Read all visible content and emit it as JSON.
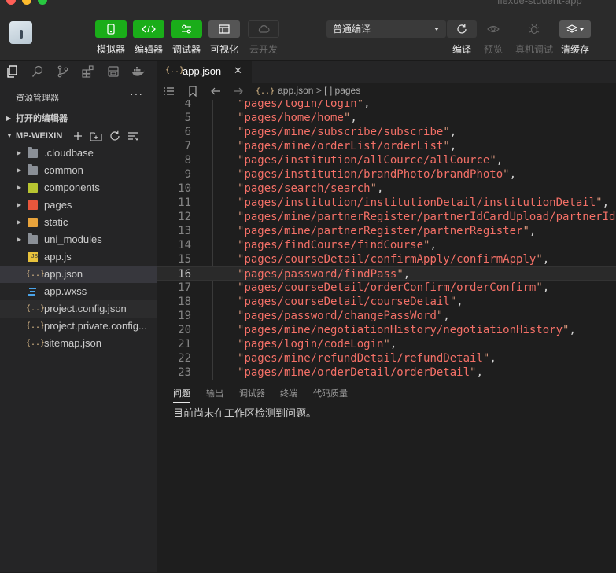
{
  "window": {
    "title": "flexue-student-app"
  },
  "toolbar": {
    "simulator_label": "模拟器",
    "editor_label": "编辑器",
    "debugger_label": "调试器",
    "visual_label": "可视化",
    "cloud_label": "云开发",
    "compile_mode": "普通编译",
    "compile_label": "编译",
    "preview_label": "预览",
    "remote_debug_label": "真机调试",
    "clear_cache_label": "清缓存"
  },
  "sidebar": {
    "title": "资源管理器",
    "more": "···",
    "open_editors": "打开的编辑器",
    "project": "MP-WEIXIN",
    "tree": [
      {
        "name": ".cloudbase",
        "type": "folder"
      },
      {
        "name": "common",
        "type": "folder"
      },
      {
        "name": "components",
        "type": "folder"
      },
      {
        "name": "pages",
        "type": "folder"
      },
      {
        "name": "static",
        "type": "folder"
      },
      {
        "name": "uni_modules",
        "type": "folder"
      },
      {
        "name": "app.js",
        "type": "file"
      },
      {
        "name": "app.json",
        "type": "file"
      },
      {
        "name": "app.wxss",
        "type": "file"
      },
      {
        "name": "project.config.json",
        "type": "file"
      },
      {
        "name": "project.private.config...",
        "type": "file"
      },
      {
        "name": "sitemap.json",
        "type": "file"
      }
    ]
  },
  "editor": {
    "tab": {
      "name": "app.json",
      "icon": "{..}",
      "close": "✕"
    },
    "breadcrumb": {
      "file": "app.json",
      "sep": ">",
      "node_icon": "[ ]",
      "node": "pages"
    },
    "current_line": 16,
    "lines": [
      {
        "n": "4",
        "text": "pages/login/login"
      },
      {
        "n": "5",
        "text": "pages/home/home"
      },
      {
        "n": "6",
        "text": "pages/mine/subscribe/subscribe"
      },
      {
        "n": "7",
        "text": "pages/mine/orderList/orderList"
      },
      {
        "n": "8",
        "text": "pages/institution/allCource/allCource"
      },
      {
        "n": "9",
        "text": "pages/institution/brandPhoto/brandPhoto"
      },
      {
        "n": "10",
        "text": "pages/search/search"
      },
      {
        "n": "11",
        "text": "pages/institution/institutionDetail/institutionDetail"
      },
      {
        "n": "12",
        "text": "pages/mine/partnerRegister/partnerIdCardUpload/partnerId"
      },
      {
        "n": "13",
        "text": "pages/mine/partnerRegister/partnerRegister"
      },
      {
        "n": "14",
        "text": "pages/findCourse/findCourse"
      },
      {
        "n": "15",
        "text": "pages/courseDetail/confirmApply/confirmApply"
      },
      {
        "n": "16",
        "text": "pages/password/findPass"
      },
      {
        "n": "17",
        "text": "pages/courseDetail/orderConfirm/orderConfirm"
      },
      {
        "n": "18",
        "text": "pages/courseDetail/courseDetail"
      },
      {
        "n": "19",
        "text": "pages/password/changePassWord"
      },
      {
        "n": "20",
        "text": "pages/mine/negotiationHistory/negotiationHistory"
      },
      {
        "n": "21",
        "text": "pages/login/codeLogin"
      },
      {
        "n": "22",
        "text": "pages/mine/refundDetail/refundDetail"
      },
      {
        "n": "23",
        "text": "pages/mine/orderDetail/orderDetail"
      }
    ]
  },
  "panel": {
    "tabs": [
      "问题",
      "输出",
      "调试器",
      "终端",
      "代码质量"
    ],
    "message": "目前尚未在工作区检测到问题。"
  },
  "colors": {
    "accent_green": "#1aad19",
    "string": "#f47067",
    "json_icon": "#e2c08d"
  }
}
